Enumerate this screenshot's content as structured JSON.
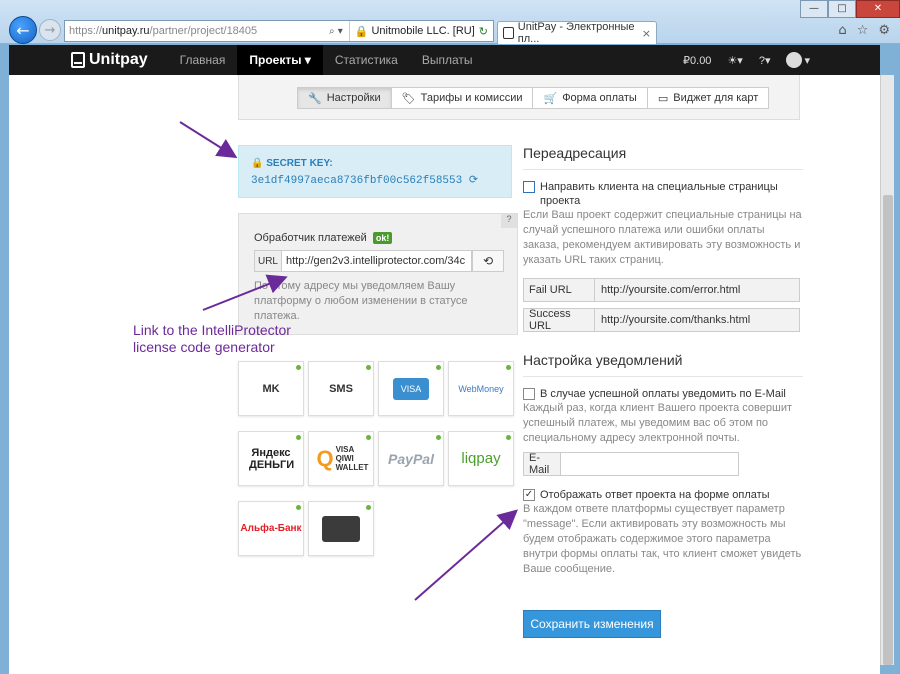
{
  "browser": {
    "url_prefix": "https://",
    "url_host": "unitpay.ru",
    "url_path": "/partner/project/18405",
    "cert_label": "Unitmobile LLC. [RU]",
    "tab_title": "UnitPay - Электронные пл...",
    "tab_close": "×",
    "win_min": "—",
    "win_max": "□",
    "win_close": "✕",
    "back_glyph": "←",
    "fwd_glyph": "→",
    "tool_home": "⌂",
    "tool_star": "☆",
    "tool_gear": "⚙"
  },
  "navbar": {
    "brand": "Unitpay",
    "items": [
      "Главная",
      "Проекты ▾",
      "Статистика",
      "Выплаты"
    ],
    "balance": "₽0.00",
    "bulb": "☀▾",
    "help": "?▾",
    "user_caret": "▾"
  },
  "project_tabs": [
    {
      "icon": "wrench-icon",
      "glyph": "🔧",
      "label": "Настройки"
    },
    {
      "icon": "tag-icon",
      "glyph": "🏷",
      "label": "Тарифы и комиссии"
    },
    {
      "icon": "cart-icon",
      "glyph": "🛒",
      "label": "Форма оплаты"
    },
    {
      "icon": "card-icon",
      "glyph": "▭",
      "label": "Виджет для карт"
    }
  ],
  "secret": {
    "label": "🔒 SECRET KEY:",
    "value": "3e1df4997aeca8736fbf00c562f58553 ⟳"
  },
  "handler": {
    "question": "?",
    "title": "Обработчик платежей",
    "ok": "ok!",
    "url_addon": "URL",
    "url_value": "http://gen2v3.intelliprotector.com/34c",
    "refresh": "⟲",
    "help": "По этому адресу мы уведомляем Вашу платформу о любом изменении в статусе платежа."
  },
  "annotation": {
    "line1": "Link to the IntelliProtector",
    "line2": "license code generator"
  },
  "payment_methods": [
    {
      "name": "mk-mobile-icon",
      "label": "MK"
    },
    {
      "name": "sms-icon",
      "label": "SMS"
    },
    {
      "name": "bank-cards-icon",
      "label": "VISA"
    },
    {
      "name": "webmoney-icon",
      "label": "WebMoney"
    },
    {
      "name": "yandex-money-icon",
      "label": "Яндекс ДЕНЬГИ"
    },
    {
      "name": "qiwi-icon",
      "label": "VISA QIWI WALLET"
    },
    {
      "name": "paypal-icon",
      "label": "PayPal"
    },
    {
      "name": "liqpay-icon",
      "label": "liqpay"
    },
    {
      "name": "alfabank-icon",
      "label": "Альфа-Банк"
    },
    {
      "name": "wallet-icon",
      "label": ""
    }
  ],
  "redirect": {
    "title": "Переадресация",
    "checkbox_label": "Направить клиента на специальные страницы проекта",
    "help": "Если Ваш проект содержит специальные страницы на случай успешного платежа или ошибки оплаты заказа, рекомендуем активировать эту возможность и указать URL таких страниц.",
    "fail_label": "Fail URL",
    "fail_value": "http://yoursite.com/error.html",
    "success_label": "Success URL",
    "success_value": "http://yoursite.com/thanks.html"
  },
  "notifications": {
    "title": "Настройка уведомлений",
    "email_checkbox": "В случае успешной оплаты уведомить по E-Mail",
    "email_help": "Каждый раз, когда клиент Вашего проекта совершит успешный платеж, мы уведомим вас об этом по специальному адресу электронной почты.",
    "email_label": "E-Mail",
    "email_value": "",
    "response_checkbox": "Отображать ответ проекта на форме оплаты",
    "response_checked": true,
    "response_mark": "✓",
    "response_help": "В каждом ответе платформы существует параметр \"message\". Если активировать эту возможность мы будем отображать содержимое этого параметра внутри формы оплаты так, что клиент сможет увидеть Ваше сообщение."
  },
  "save_button": "Сохранить изменения",
  "colors": {
    "accent": "#3596dc",
    "annotation": "#6b2a99",
    "secret_bg": "#d9edf7",
    "navbar_bg": "#1a1a1a"
  }
}
